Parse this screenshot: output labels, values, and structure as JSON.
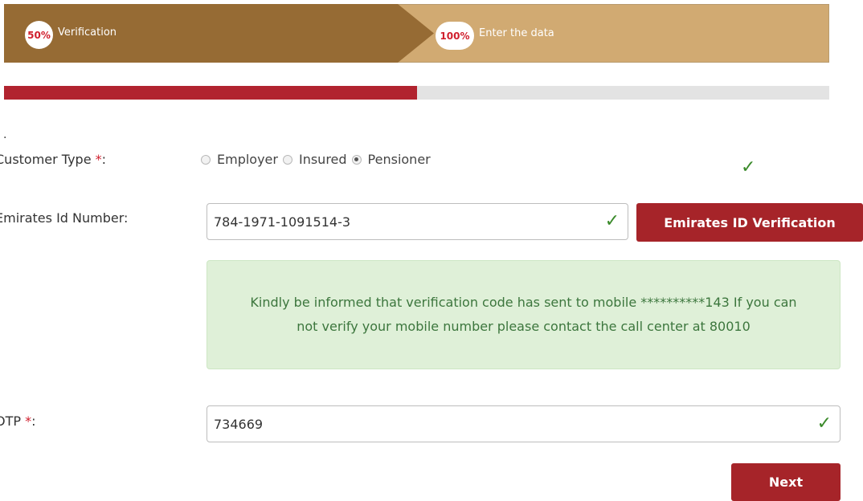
{
  "steps": [
    {
      "percent": "50%",
      "label": "Verification"
    },
    {
      "percent": "100%",
      "label": "Enter the data"
    }
  ],
  "progress": {
    "value_percent": 50,
    "fill_color": "#b1232f",
    "track_color": "#e3e3e3"
  },
  "colors": {
    "step_active": "#966b34",
    "step_pending": "#d1aa72",
    "accent": "#a62429",
    "success_text": "#3c763d",
    "success_bg": "#dff0d8"
  },
  "dot": ".",
  "form": {
    "customer_type": {
      "label": "Customer Type ",
      "required_mark": "*",
      "suffix": ":",
      "options": [
        {
          "label": "Employer",
          "checked": false
        },
        {
          "label": "Insured",
          "checked": false
        },
        {
          "label": "Pensioner",
          "checked": true
        }
      ],
      "check_icon": "check-icon"
    },
    "emirates_id": {
      "label": "Emirates Id Number:",
      "value": "784-1971-1091514-3",
      "verify_button": "Emirates ID Verification"
    },
    "alert": "Kindly be informed that verification code has sent to mobile **********143 If you can not verify your mobile number please contact the call center at 80010",
    "otp": {
      "label": "OTP ",
      "required_mark": "*",
      "suffix": ":",
      "value": "734669"
    },
    "next_button": "Next"
  }
}
